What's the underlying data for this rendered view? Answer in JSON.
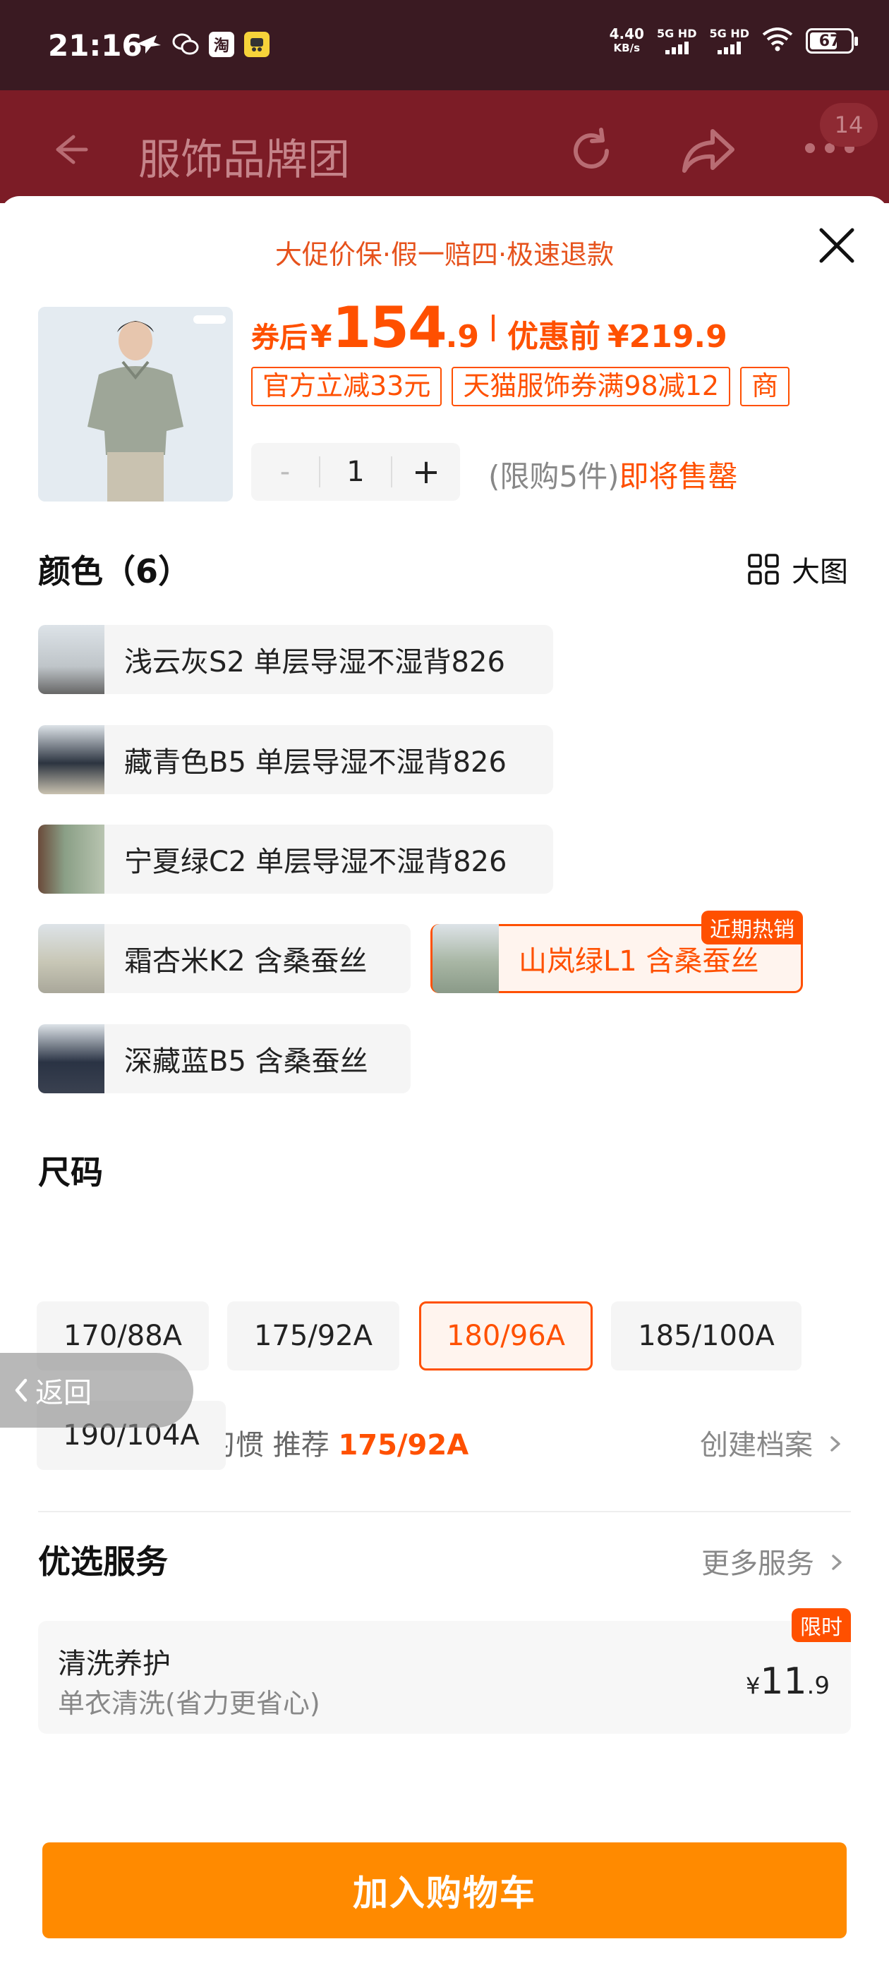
{
  "status_bar": {
    "time": "21:16",
    "speed_value": "4.40",
    "speed_unit": "KB/s",
    "signal1_label": "5G HD",
    "signal2_label": "5G HD",
    "battery": "67",
    "icons": [
      "bird-icon",
      "wechat-icon",
      "taobao-icon",
      "yellow-app-icon",
      "wifi-icon"
    ]
  },
  "app_bar": {
    "title": "服饰品牌团",
    "badge": "14"
  },
  "sheet": {
    "promo_banner": "大促价保·假一赔四·极速退款",
    "price": {
      "prefix": "券后",
      "currency": "¥",
      "integer": "154",
      "decimal": ".9",
      "orig_label": "优惠前",
      "orig_value": "¥219.9"
    },
    "coupons": [
      "官方立减33元",
      "天猫服饰券满98减12",
      "商"
    ],
    "quantity": {
      "minus": "-",
      "value": "1",
      "plus": "+"
    },
    "limit_text": "(限购5件)",
    "limit_status": "即将售罄",
    "color_section": {
      "title": "颜色（6）",
      "big_view_label": "大图",
      "options": [
        {
          "label": "浅云灰S2 单层导湿不湿背826"
        },
        {
          "label": "藏青色B5 单层导湿不湿背826"
        },
        {
          "label": "宁夏绿C2 单层导湿不湿背826"
        },
        {
          "label": "霜杏米K2 含桑蚕丝"
        },
        {
          "label": "山岚绿L1 含桑蚕丝",
          "tag": "近期热销"
        },
        {
          "label": "深藏蓝B5 含桑蚕丝"
        }
      ]
    },
    "size_section": {
      "title": "尺码",
      "recommend_prefix": "根据您的购买习惯 推荐",
      "recommend_value": "175/92A",
      "create_profile": "创建档案",
      "options": [
        "170/88A",
        "175/92A",
        "180/96A",
        "185/100A",
        "190/104A"
      ],
      "selected": "180/96A"
    },
    "back_float": "返回",
    "services": {
      "title": "优选服务",
      "more": "更多服务",
      "card": {
        "tag": "限时",
        "name": "清洗养护",
        "desc": "单衣清洗(省力更省心)",
        "price_currency": "¥",
        "price_integer": "11",
        "price_decimal": ".9"
      }
    },
    "cart_button": "加入购物车"
  },
  "colors": {
    "accent": "#ff5000",
    "cart_button": "#ff8a00",
    "status_bar": "#3a1a22",
    "header_dimmed": "#7c1c26"
  }
}
